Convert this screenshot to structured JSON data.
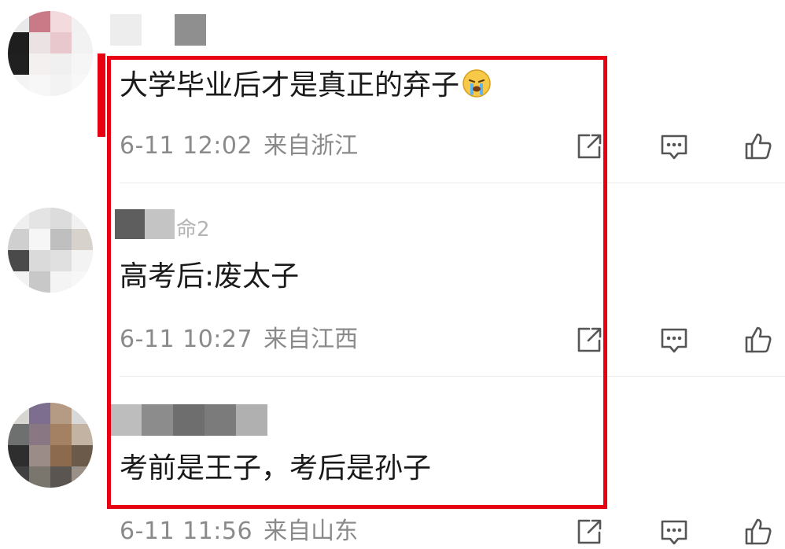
{
  "colors": {
    "highlight": "#e60012",
    "text": "#1a1a1a",
    "meta": "#8a8a8a",
    "icon": "#555555"
  },
  "comments": [
    {
      "text": "大学毕业后才是真正的弃子",
      "emoji": "loudly-crying-face",
      "time": "6-11 12:02",
      "location": "来自浙江",
      "icons": [
        "share-icon",
        "reply-icon",
        "like-icon"
      ]
    },
    {
      "username_partial": "命2",
      "text": "高考后:废太子",
      "time": "6-11 10:27",
      "location": "来自江西",
      "icons": [
        "share-icon",
        "reply-icon",
        "like-icon"
      ]
    },
    {
      "text": "考前是王子，考后是孙子",
      "time": "6-11 11:56",
      "location": "来自山东",
      "icons": [
        "share-icon",
        "reply-icon",
        "like-icon"
      ]
    }
  ]
}
